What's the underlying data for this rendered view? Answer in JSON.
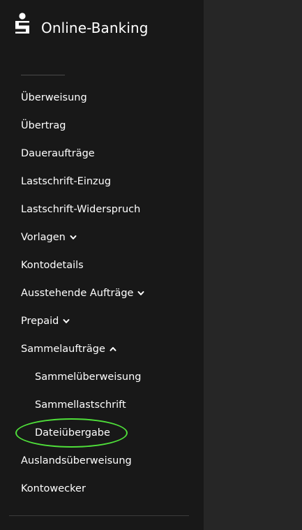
{
  "brand": {
    "title": "Online-Banking",
    "logo_icon": "sparkasse-logo-icon"
  },
  "nav": {
    "items": [
      {
        "label": "Überweisung"
      },
      {
        "label": "Übertrag"
      },
      {
        "label": "Daueraufträge"
      },
      {
        "label": "Lastschrift-Einzug"
      },
      {
        "label": "Lastschrift-Widerspruch"
      },
      {
        "label": "Vorlagen",
        "icon": "chevron-down-icon"
      },
      {
        "label": "Kontodetails"
      },
      {
        "label": "Ausstehende Aufträge",
        "icon": "chevron-down-icon"
      },
      {
        "label": "Prepaid",
        "icon": "chevron-down-icon"
      },
      {
        "label": "Sammelaufträge",
        "icon": "chevron-up-icon"
      },
      {
        "label": "Sammelüberweisung"
      },
      {
        "label": "Sammellastschrift"
      },
      {
        "label": "Dateiübergabe",
        "highlighted": true
      },
      {
        "label": "Auslandsüberweisung"
      },
      {
        "label": "Kontowecker"
      }
    ]
  },
  "colors": {
    "sidebar_bg": "#181818",
    "content_bg": "#262626",
    "text": "#ffffff",
    "highlight": "#4fe03a"
  }
}
